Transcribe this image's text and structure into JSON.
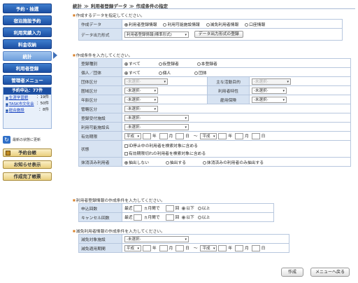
{
  "sidebar": {
    "nav": [
      {
        "label": "予約・抽選"
      },
      {
        "label": "宿泊施設予約"
      },
      {
        "label": "利用実績入力"
      },
      {
        "label": "料金収納"
      },
      {
        "label": "統計"
      },
      {
        "label": "利用者登録"
      },
      {
        "label": "管理者メニュー"
      }
    ],
    "requests": {
      "title": "予約申込：77件",
      "rows": [
        {
          "name": "生涯学習館",
          "count": "：19件"
        },
        {
          "name": "TASK市文化会",
          "count": "：50件"
        },
        {
          "name": "総合施設",
          "count": "：8件"
        }
      ]
    },
    "refresh_label": "最新の状態に更新",
    "buttons": [
      {
        "label": "予約台帳"
      },
      {
        "label": "お知らせ表示"
      },
      {
        "label": "作成完了帳票"
      }
    ]
  },
  "breadcrumb": {
    "items": [
      "統計",
      "利用者登録データ",
      "作成条件の指定"
    ],
    "sep": "≫"
  },
  "section1": {
    "head": "作成するデータを指定してください。",
    "rows": {
      "data_label": "作成データ",
      "data_options": [
        "利用者登録情報",
        "利用可能施設情報",
        "減免利用者情報",
        "口座情報"
      ],
      "format_label": "データ出力形式",
      "format_value": "利用者登録情報(標準形式)",
      "format_button": "データ出力形式の登録"
    }
  },
  "section2": {
    "head": "作成条件を入力してください。",
    "reg_type_label": "登録種別",
    "reg_type_options": [
      "すべて",
      "仮登録者",
      "本登録者"
    ],
    "person_label": "個人／団体",
    "person_options": [
      "すべて",
      "個人",
      "団体"
    ],
    "group_type_label": "団体区分",
    "group_type_value": "-未選択-",
    "purpose_label": "主な活動目的",
    "purpose_value": "-未選択-",
    "area_label": "圏域区分",
    "area_value": "-未選択-",
    "user_attr_label": "利用者特性",
    "user_attr_value": "-未選択-",
    "age_label": "年齢区分",
    "age_value": "-未選択-",
    "employ_label": "雇用保険",
    "employ_value": "-未選択-",
    "jurisdiction_label": "管轄区分",
    "jurisdiction_value": "-未選択-",
    "reg_facility_label": "登録受付施設",
    "reg_facility_value": "-未選択-",
    "usable_facility_label": "利用可能施設名",
    "usable_facility_value": "-未選択-",
    "valid_period_label": "有効期限",
    "era": "平成",
    "year": "年",
    "month": "月",
    "day": "日",
    "range_sep": "〜",
    "status_label": "状態",
    "status_checks": [
      "ID停止中の利用者を検索対象に含める",
      "有効期限切れの利用者を検索対象に含める"
    ],
    "deleted_label": "抹消済み利用者",
    "deleted_options": [
      "抽出しない",
      "抽出する",
      "抹消済みの利用者のみ抽出する"
    ]
  },
  "section3": {
    "head": "利用者登録情報の作成条件を入力してください。",
    "apply_label": "申込回数",
    "cancel_label": "キャンセル回数",
    "recent": "最近",
    "months_within": "ヵ月間で",
    "times": "回",
    "cmp_options": [
      "以下",
      "以上"
    ]
  },
  "section4": {
    "head": "減免利用者情報の作成条件を入力してください。",
    "target_label": "減免対象施設",
    "target_value": "-未選択-",
    "period_label": "減免適用期間"
  },
  "footer": {
    "create": "作成",
    "back": "メニューへ戻る"
  }
}
